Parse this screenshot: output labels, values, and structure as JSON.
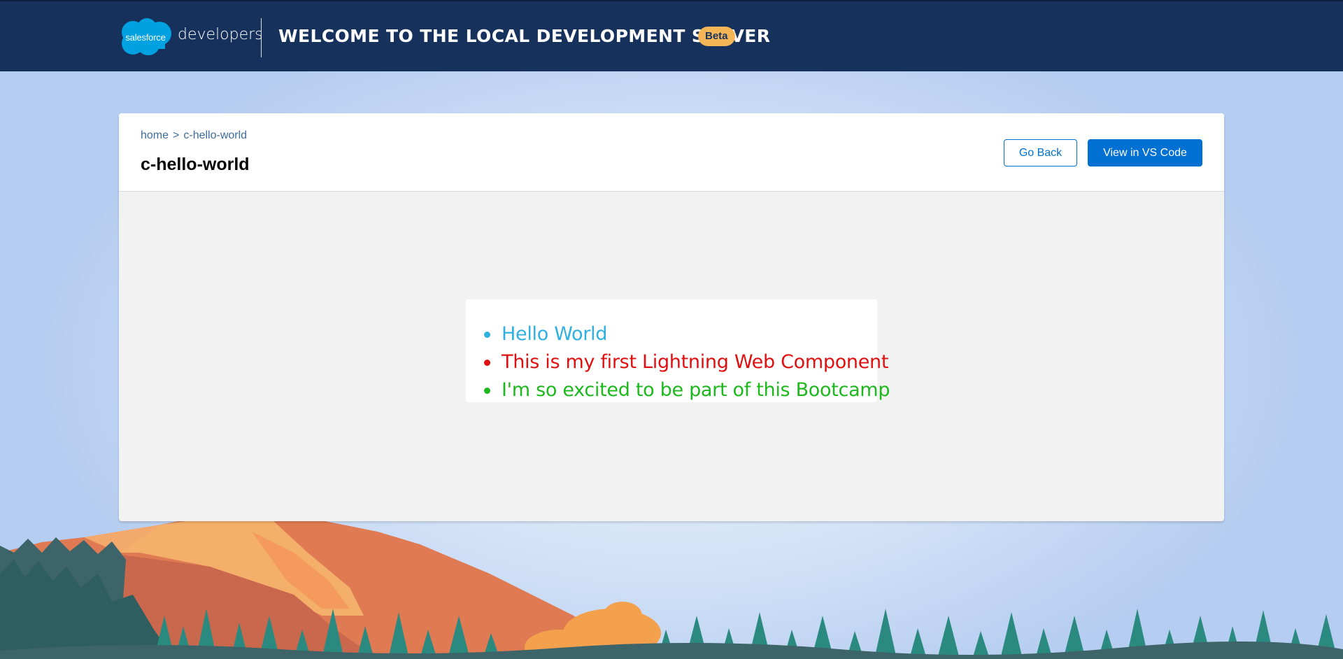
{
  "header": {
    "logo_text": "salesforce",
    "brand_word": "developers",
    "title": "WELCOME TO THE LOCAL DEVELOPMENT SERVER",
    "badge": "Beta"
  },
  "breadcrumb": {
    "home": "home",
    "separator": ">",
    "current": "c-hello-world"
  },
  "page_title": "c-hello-world",
  "buttons": {
    "go_back": "Go Back",
    "view_in_vs_code": "View in VS Code"
  },
  "component": {
    "items": [
      {
        "text": "Hello World",
        "color": "#2fb0e0"
      },
      {
        "text": "This is my first Lightning Web Component",
        "color": "#e01010"
      },
      {
        "text": "I'm so excited to be part of this Bootcamp",
        "color": "#1eb81e"
      }
    ]
  },
  "colors": {
    "header_bg": "#16325c",
    "brand_blue": "#0070d2",
    "badge_bg": "#f4b557",
    "cloud_blue": "#00a1e0"
  }
}
